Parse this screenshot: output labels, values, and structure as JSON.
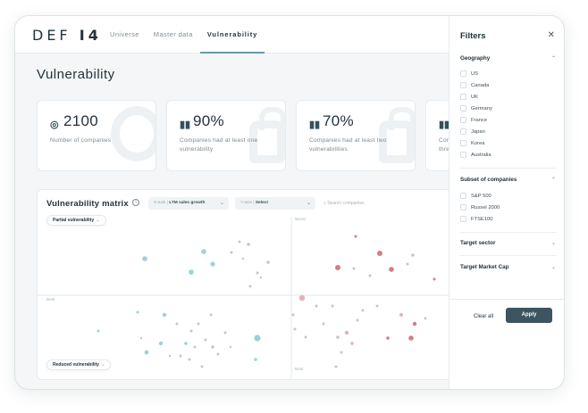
{
  "app": {
    "logo": "DEF",
    "logo_mark": "I4"
  },
  "nav": {
    "items": [
      {
        "label": "Universe",
        "active": false
      },
      {
        "label": "Master data",
        "active": false
      },
      {
        "label": "Vulnerability",
        "active": true
      }
    ]
  },
  "page": {
    "title": "Vulnerability"
  },
  "cards": [
    {
      "icon": "target-icon",
      "icon_glyph": "◎",
      "value": "2100",
      "label": "Number of companies"
    },
    {
      "icon": "lock-icon",
      "icon_glyph": "▮▮",
      "value": "90%",
      "label": "Companies had at least one vulnerability"
    },
    {
      "icon": "lock-icon",
      "icon_glyph": "▮▮",
      "value": "70%",
      "label": "Companies had at least two vulnerabilities"
    },
    {
      "icon": "lock-icon",
      "icon_glyph": "▮▮",
      "value": "",
      "label": "Con thre"
    }
  ],
  "matrix": {
    "title": "Vulnerability matrix",
    "x_axis_select": {
      "prefix": "X-axis",
      "value": "LTM sales growth"
    },
    "y_axis_select": {
      "prefix": "Y-axis",
      "value": "Select"
    },
    "search_placeholder": "Search companies",
    "partial_button": "Partial vulnerability →",
    "reduced_button": "Reduced vulnerability →",
    "label_worst": "Worst",
    "label_best_left": "Best",
    "label_best_bottom": "Best",
    "colors": {
      "teal": "#8fcdd8",
      "grey": "#b9c1c6",
      "red": "#cf6f78",
      "pink": "#e4a9ae"
    }
  },
  "filters": {
    "title": "Filters",
    "close_icon": "close-icon",
    "geography": {
      "label": "Geography",
      "options": [
        "US",
        "Canada",
        "UK",
        "Germany",
        "France",
        "Japan",
        "Korea",
        "Australia"
      ]
    },
    "subset": {
      "label": "Subset of companies",
      "options": [
        "S&P 500",
        "Russel 2000",
        "FTSE100"
      ]
    },
    "target_sector": {
      "label": "Target sector"
    },
    "target_market_cap": {
      "label": "Target Market Cap"
    },
    "clear_label": "Clear all",
    "apply_label": "Apply"
  }
}
